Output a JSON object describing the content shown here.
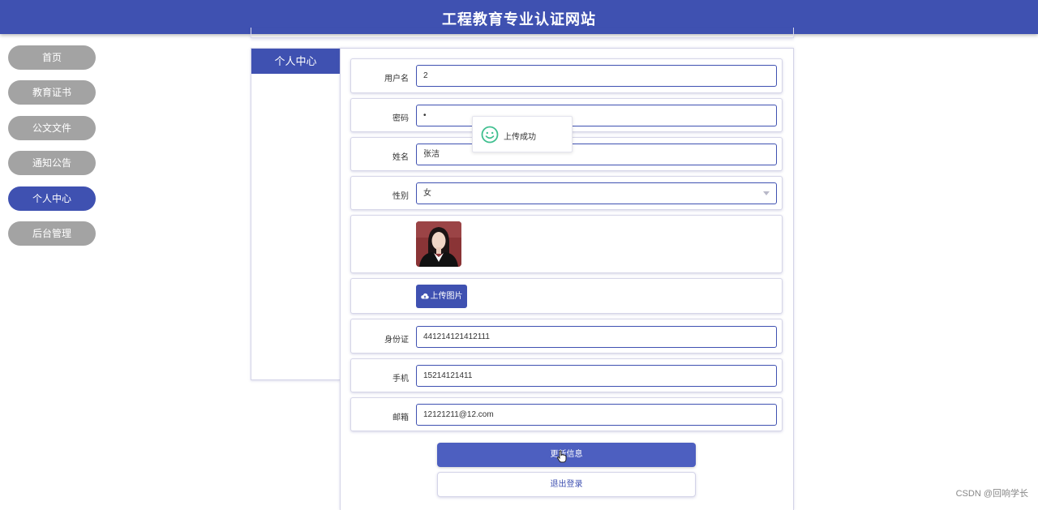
{
  "header": {
    "title": "工程教育专业认证网站"
  },
  "nav": {
    "items": [
      {
        "label": "首页"
      },
      {
        "label": "教育证书"
      },
      {
        "label": "公文文件"
      },
      {
        "label": "通知公告"
      },
      {
        "label": "个人中心"
      },
      {
        "label": "后台管理"
      }
    ]
  },
  "side_panel": {
    "title": "个人中心"
  },
  "form": {
    "username": {
      "label": "用户名",
      "value": "2"
    },
    "password": {
      "label": "密码",
      "value": "•"
    },
    "name": {
      "label": "姓名",
      "value": "张洁"
    },
    "gender": {
      "label": "性别",
      "value": "女"
    },
    "upload_button": "上传图片",
    "id_card": {
      "label": "身份证",
      "value": "441214121412111"
    },
    "phone": {
      "label": "手机",
      "value": "15214121411"
    },
    "email": {
      "label": "邮箱",
      "value": "12121211@12.com"
    },
    "submit_button": "更新信息",
    "logout_button": "退出登录"
  },
  "toast": {
    "message": "上传成功"
  },
  "watermark": "CSDN @回响学长",
  "colors": {
    "primary": "#3f51b1",
    "nav_inactive": "#a3a3a3",
    "success": "#3fbf8f"
  }
}
